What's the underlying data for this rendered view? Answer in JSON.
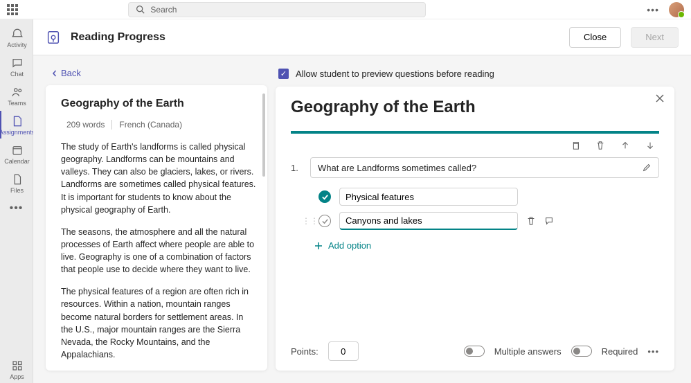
{
  "search": {
    "placeholder": "Search"
  },
  "rail": {
    "items": [
      {
        "label": "Activity"
      },
      {
        "label": "Chat"
      },
      {
        "label": "Teams"
      },
      {
        "label": "Assignments"
      },
      {
        "label": "Calendar"
      },
      {
        "label": "Files"
      }
    ],
    "apps_label": "Apps"
  },
  "header": {
    "title": "Reading Progress",
    "close_label": "Close",
    "next_label": "Next"
  },
  "back_label": "Back",
  "reading": {
    "title": "Geography of the Earth",
    "word_count": "209 words",
    "language": "French (Canada)",
    "para1": "The study of Earth's landforms is called physical geography. Landforms can be mountains and valleys. They can also be glaciers, lakes, or rivers. Landforms are sometimes called physical features. It is important for students to know about the physical geography of Earth.",
    "para2": "The seasons, the atmosphere and all the natural processes of Earth affect where people are able to live. Geography is one of a combination of factors that people use to decide where they want to live.",
    "para3": "The physical features of a region are often rich in resources. Within a nation, mountain ranges become natural borders for settlement areas. In the U.S., major mountain ranges are the Sierra Nevada, the Rocky Mountains, and the Appalachians."
  },
  "allow_preview": {
    "label": "Allow student to preview questions before reading",
    "checked": true
  },
  "question": {
    "title": "Geography of the Earth",
    "number": "1.",
    "text": "What are Landforms sometimes called?",
    "options": [
      {
        "text": "Physical features",
        "correct": true
      },
      {
        "text": "Canyons and lakes",
        "correct": false,
        "editing": true
      }
    ],
    "add_option_label": "Add option",
    "points_label": "Points:",
    "points_value": "0",
    "multi_label": "Multiple answers",
    "required_label": "Required"
  }
}
